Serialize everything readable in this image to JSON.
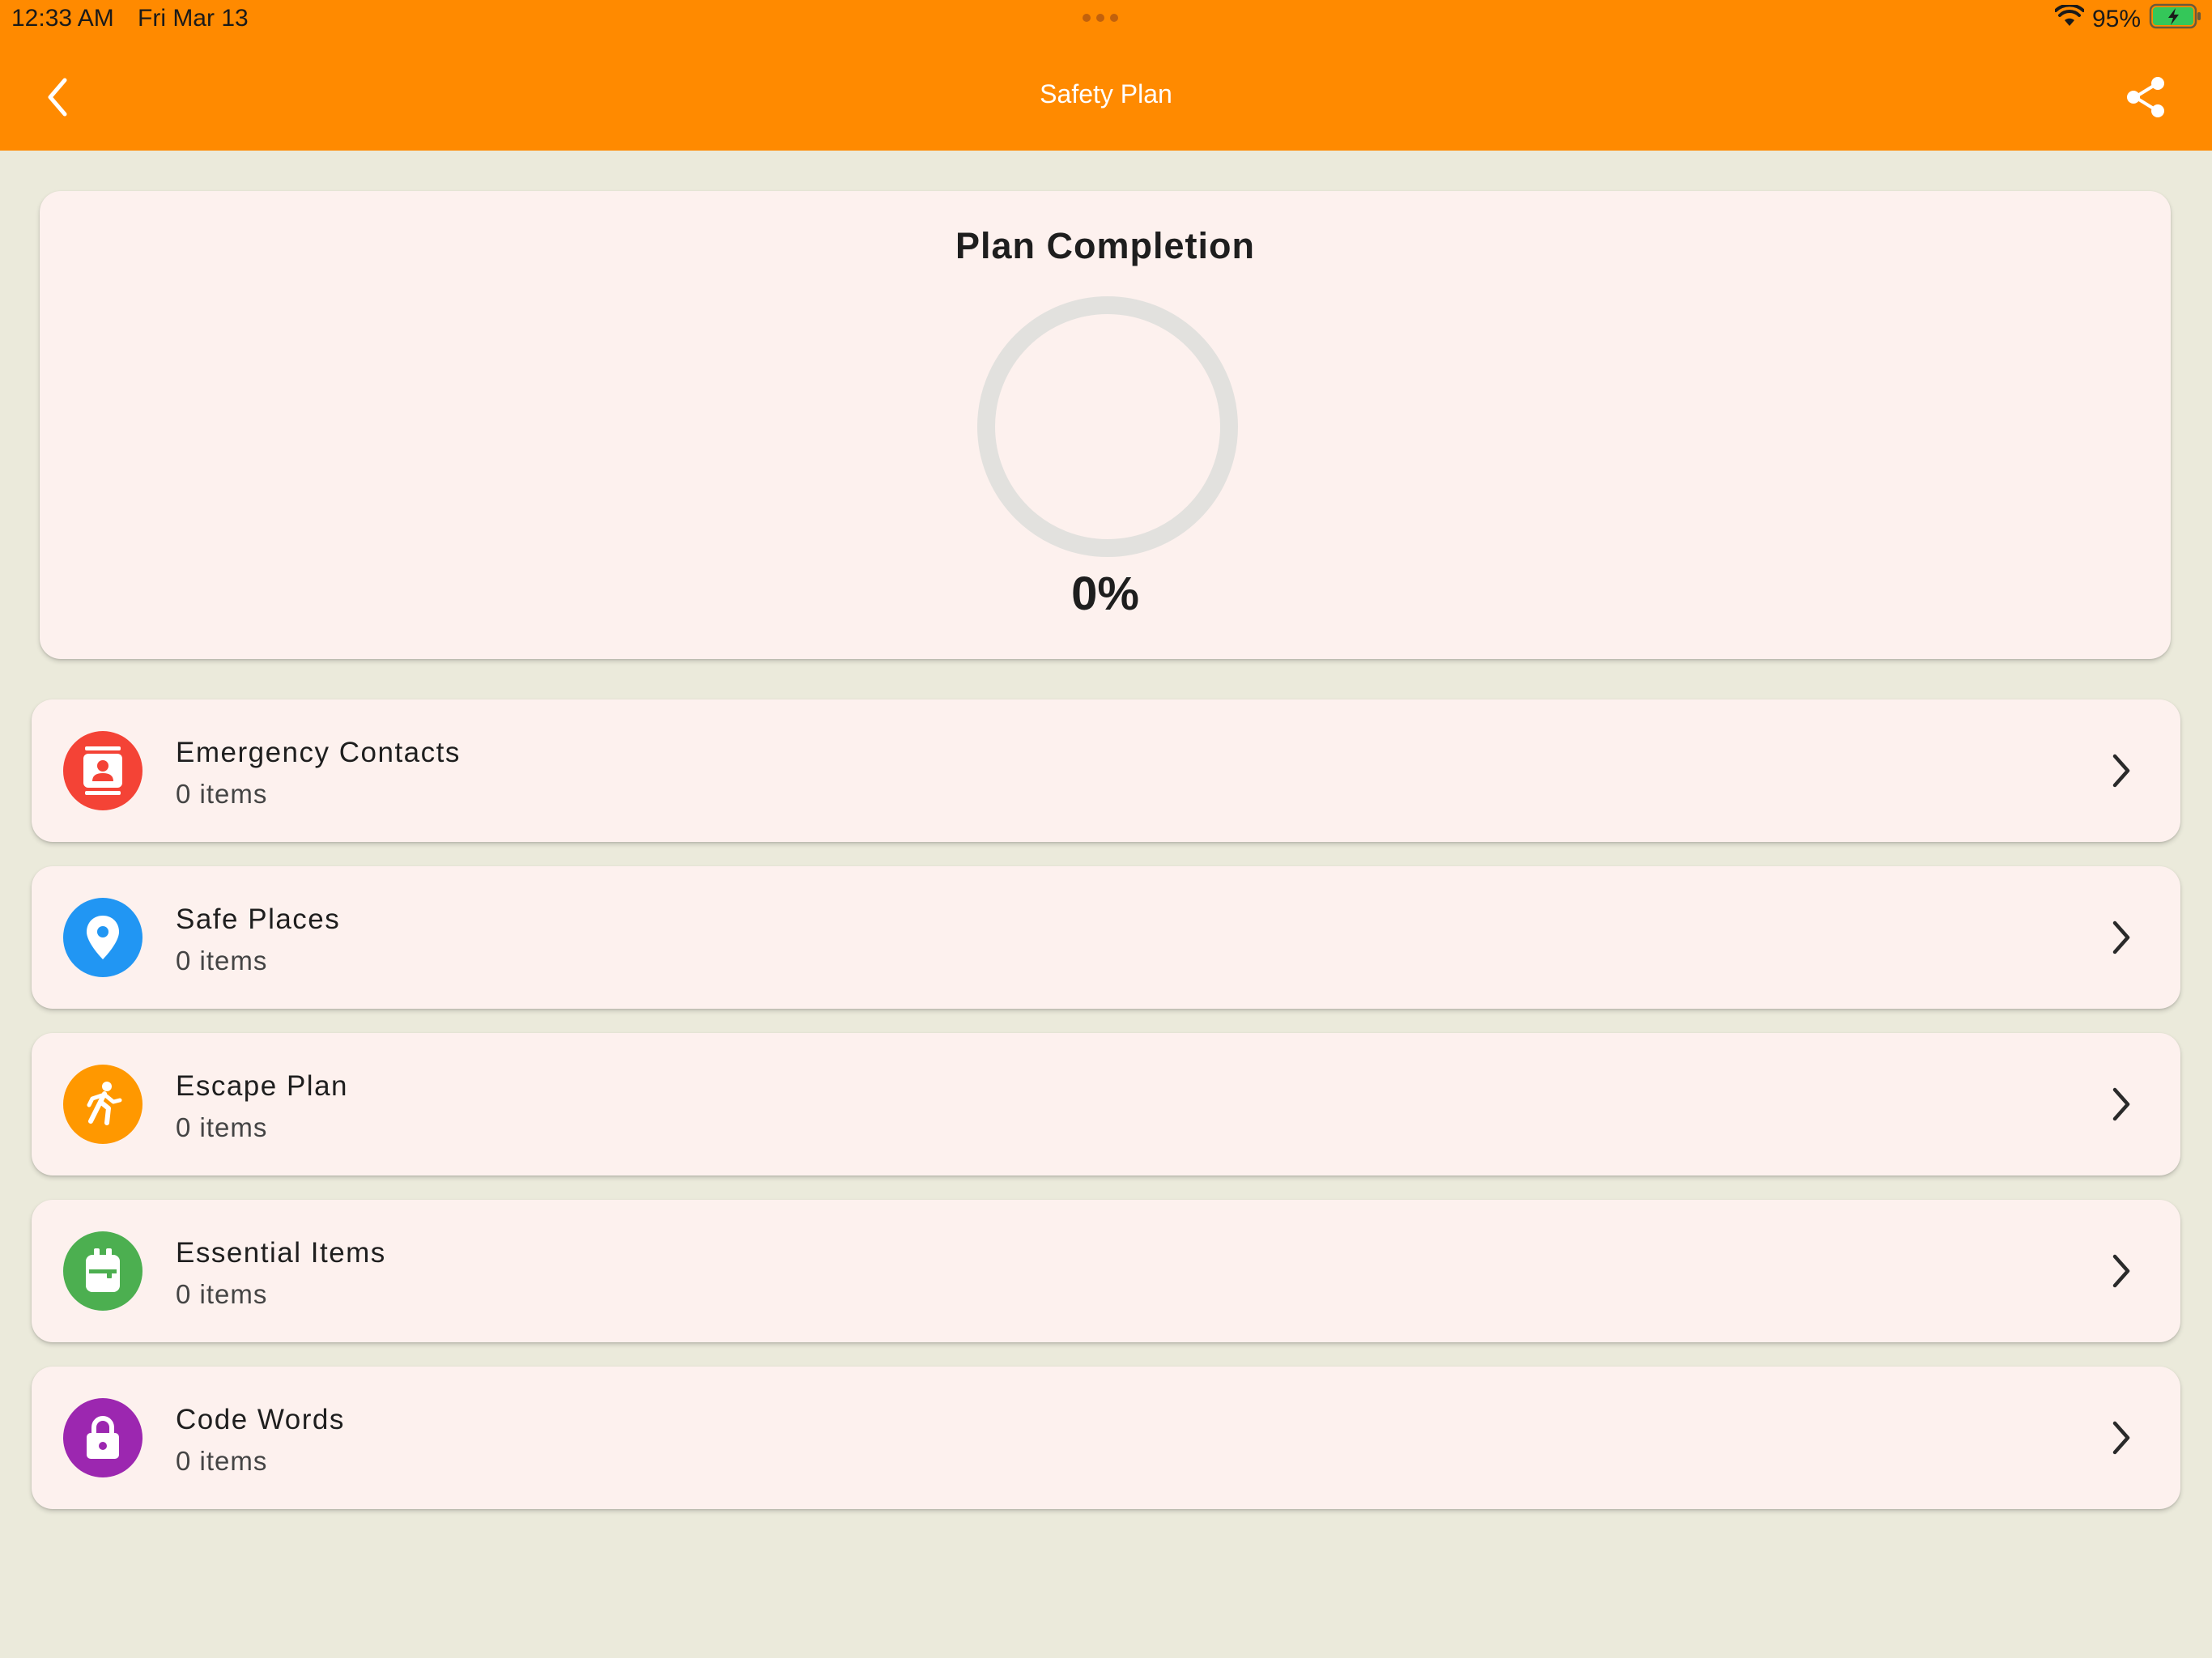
{
  "status_bar": {
    "time": "12:33 AM",
    "date": "Fri Mar 13",
    "battery_percent": "95%",
    "icons": [
      "wifi-icon",
      "battery-charging-icon"
    ]
  },
  "nav": {
    "title": "Safety Plan",
    "back_icon": "chevron-left-icon",
    "share_icon": "share-icon"
  },
  "completion": {
    "title": "Plan Completion",
    "percent_label": "0%",
    "percent_value": 0,
    "ring_track_color": "#E2E1DE",
    "ring_fill_color": "#FF8A00"
  },
  "sections": [
    {
      "title": "Emergency Contacts",
      "count": "0 items",
      "icon": "contacts-icon",
      "color": "#F44336"
    },
    {
      "title": "Safe Places",
      "count": "0 items",
      "icon": "location-pin-icon",
      "color": "#2196F3"
    },
    {
      "title": "Escape Plan",
      "count": "0 items",
      "icon": "running-person-icon",
      "color": "#FF9800"
    },
    {
      "title": "Essential Items",
      "count": "0 items",
      "icon": "backpack-icon",
      "color": "#4CAF50"
    },
    {
      "title": "Code Words",
      "count": "0 items",
      "icon": "lock-icon",
      "color": "#9C27B0"
    }
  ],
  "colors": {
    "header": "#FF8A00",
    "background": "#EBEADB",
    "card": "#FDF1EE"
  }
}
